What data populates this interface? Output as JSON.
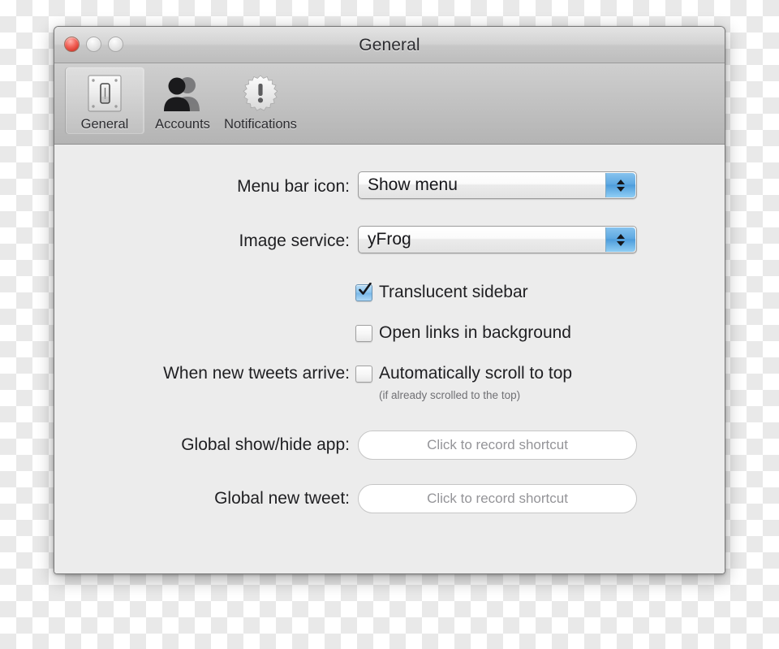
{
  "window": {
    "title": "General",
    "traffic_lights": [
      {
        "name": "close",
        "label": "Close",
        "color": "#d9392d",
        "enabled": true
      },
      {
        "name": "minimize",
        "label": "Minimize",
        "color": "#d8d8d8",
        "enabled": false
      },
      {
        "name": "zoom",
        "label": "Zoom",
        "color": "#d8d8d8",
        "enabled": false
      }
    ]
  },
  "toolbar": {
    "items": [
      {
        "label": "General",
        "icon": "light-switch-icon",
        "selected": true
      },
      {
        "label": "Accounts",
        "icon": "two-people-icon",
        "selected": false
      },
      {
        "label": "Notifications",
        "icon": "starburst-exclamation-icon",
        "selected": false
      }
    ]
  },
  "form": {
    "menu_bar_icon": {
      "label": "Menu bar icon:",
      "value": "Show menu",
      "options": [
        "Show menu"
      ]
    },
    "image_service": {
      "label": "Image service:",
      "value": "yFrog",
      "options": [
        "yFrog"
      ]
    },
    "translucent_sidebar": {
      "label": "Translucent sidebar",
      "checked": true
    },
    "open_links_background": {
      "label": "Open links in background",
      "checked": false
    },
    "new_tweets": {
      "label": "When new tweets arrive:",
      "checkbox_label": "Automatically scroll to top",
      "checked": false,
      "hint": "(if already scrolled to the top)"
    },
    "global_show_hide": {
      "label": "Global show/hide app:",
      "placeholder": "Click to record shortcut"
    },
    "global_new_tweet": {
      "label": "Global new tweet:",
      "placeholder": "Click to record shortcut"
    }
  },
  "colors": {
    "accent_blue": "#4e9ddb",
    "content_bg": "#ececec",
    "toolbar_bg": "#c4c4c4",
    "text": "#1f1f22",
    "hint_text": "#707074"
  }
}
